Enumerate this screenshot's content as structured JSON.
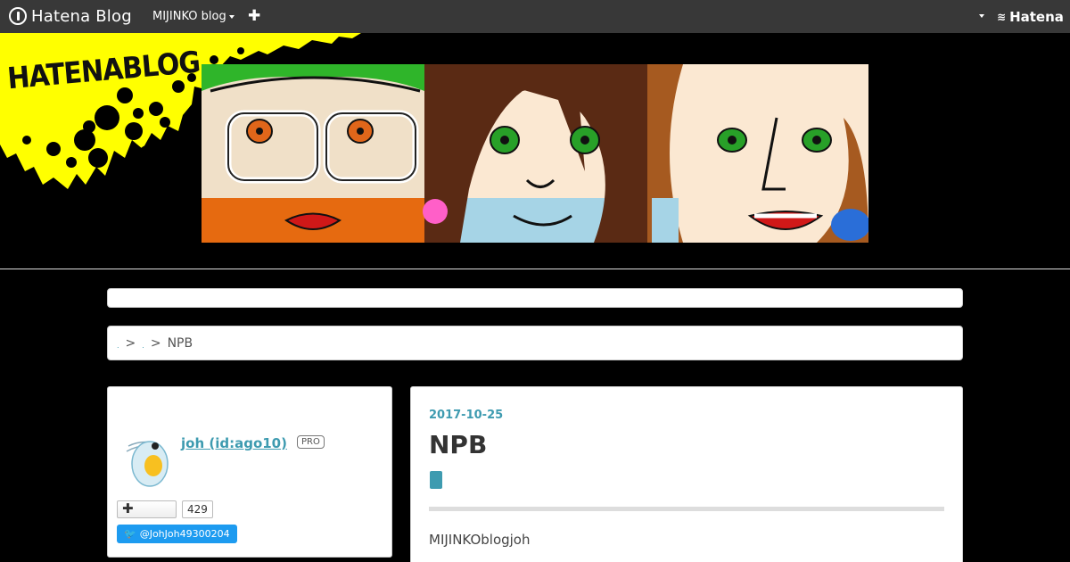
{
  "globalheader": {
    "logo_text": "Hatena Blog",
    "blog_menu_label": "MIJINKO blog",
    "add_icon": "plus-icon",
    "hatena_label": "Hatena"
  },
  "blog_header": {
    "brand_text": "HATENABLOG",
    "header_image": "three-illustrated-faces-banner"
  },
  "breadcrumb": {
    "items": [
      "​",
      "​"
    ],
    "separator": ">",
    "current": "NPB"
  },
  "profile": {
    "author": "joh (id:ago10)",
    "pro_badge": "PRO",
    "follow_count": "429",
    "twitter_handle": "@JohJoh49300204",
    "avatar_icon": "water-flea-avatar-icon"
  },
  "entry": {
    "date": "2017-10-25",
    "title": "NPB",
    "text": "MIJINKOblogjoh"
  },
  "colors": {
    "link": "#3e9bb0",
    "header_bg": "#383838",
    "page_bg": "#000000",
    "splatter": "#ffff00",
    "twitter": "#1d9bf0"
  }
}
